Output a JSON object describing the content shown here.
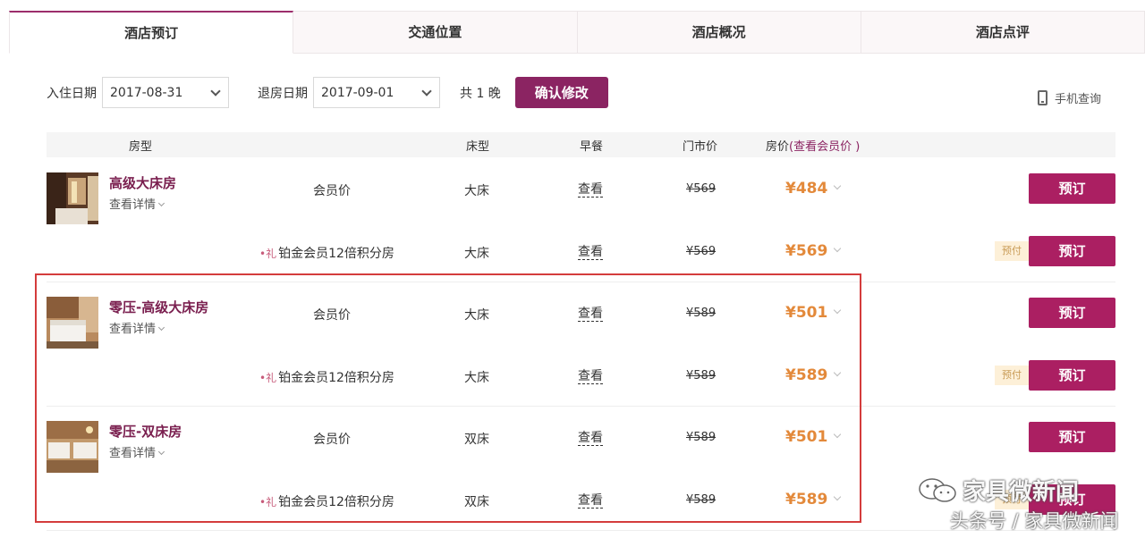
{
  "tabs": [
    "酒店预订",
    "交通位置",
    "酒店概况",
    "酒店点评"
  ],
  "dates": {
    "checkin_label": "入住日期",
    "checkin_value": "2017-08-31",
    "checkout_label": "退房日期",
    "checkout_value": "2017-09-01",
    "nights": "共 1 晚",
    "confirm": "确认修改"
  },
  "mobile_query": "手机查询",
  "header": {
    "room_type": "房型",
    "bed": "床型",
    "breakfast": "早餐",
    "list_price": "门市价",
    "price": "房价",
    "member_link": "(查看会员价 )"
  },
  "rooms": [
    {
      "name": "高级大床房",
      "details": "查看详情",
      "rates": [
        {
          "rate": "会员价",
          "gift": "",
          "bed": "大床",
          "breakfast": "查看",
          "list": "¥569",
          "price": "¥484",
          "prepay": "",
          "book": "预订"
        },
        {
          "rate": "铂金会员12倍积分房",
          "gift": "•礼",
          "bed": "大床",
          "breakfast": "查看",
          "list": "¥569",
          "price": "¥569",
          "prepay": "预付",
          "book": "预订"
        }
      ]
    },
    {
      "name": "零压-高级大床房",
      "details": "查看详情",
      "rates": [
        {
          "rate": "会员价",
          "gift": "",
          "bed": "大床",
          "breakfast": "查看",
          "list": "¥589",
          "price": "¥501",
          "prepay": "",
          "book": "预订"
        },
        {
          "rate": "铂金会员12倍积分房",
          "gift": "•礼",
          "bed": "大床",
          "breakfast": "查看",
          "list": "¥589",
          "price": "¥589",
          "prepay": "预付",
          "book": "预订"
        }
      ]
    },
    {
      "name": "零压-双床房",
      "details": "查看详情",
      "rates": [
        {
          "rate": "会员价",
          "gift": "",
          "bed": "双床",
          "breakfast": "查看",
          "list": "¥589",
          "price": "¥501",
          "prepay": "",
          "book": "预订"
        },
        {
          "rate": "铂金会员12倍积分房",
          "gift": "•礼",
          "bed": "双床",
          "breakfast": "查看",
          "list": "¥589",
          "price": "¥589",
          "prepay": "预付",
          "book": "预订"
        }
      ]
    }
  ],
  "watermark": {
    "line1": "家具微新闻",
    "line2": "头条号 / 家具微新闻"
  },
  "colors": {
    "accent": "#8b2462",
    "book": "#ab1f62",
    "price": "#e3893a",
    "highlight_box": "#d43c3c"
  }
}
